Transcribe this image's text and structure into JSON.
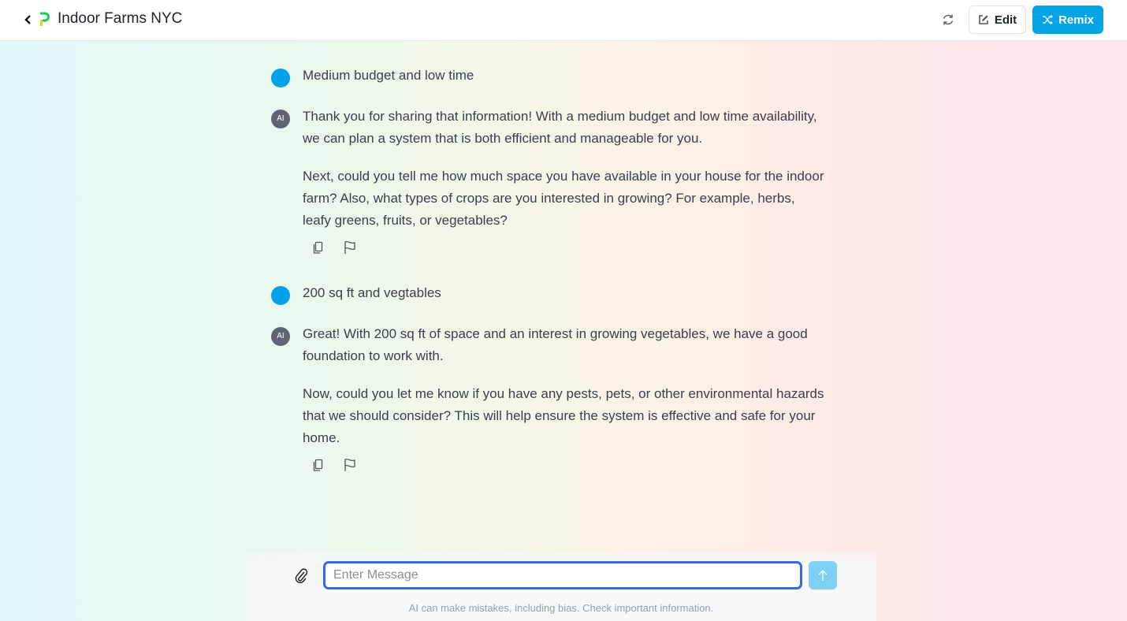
{
  "header": {
    "title": "Indoor Farms NYC",
    "edit_label": "Edit",
    "remix_label": "Remix",
    "accent": "#04a3e6"
  },
  "messages": [
    {
      "role": "user",
      "text": "Medium budget and low time"
    },
    {
      "role": "ai",
      "avatar": "AI",
      "paragraphs": [
        "Thank you for sharing that information! With a medium budget and low time availability, we can plan a system that is both efficient and manageable for you.",
        "Next, could you tell me how much space you have available in your house for the indoor farm? Also, what types of crops are you interested in growing? For example, herbs, leafy greens, fruits, or vegetables?"
      ]
    },
    {
      "role": "user",
      "text": "200 sq ft and vegtables"
    },
    {
      "role": "ai",
      "avatar": "AI",
      "paragraphs": [
        "Great! With 200 sq ft of space and an interest in growing vegetables, we have a good foundation to work with.",
        "Now, could you let me know if you have any pests, pets, or other environmental hazards that we should consider? This will help ensure the system is effective and safe for your home."
      ]
    }
  ],
  "composer": {
    "placeholder": "Enter Message",
    "value": "",
    "disclaimer": "AI can make mistakes, including bias. Check important information."
  }
}
